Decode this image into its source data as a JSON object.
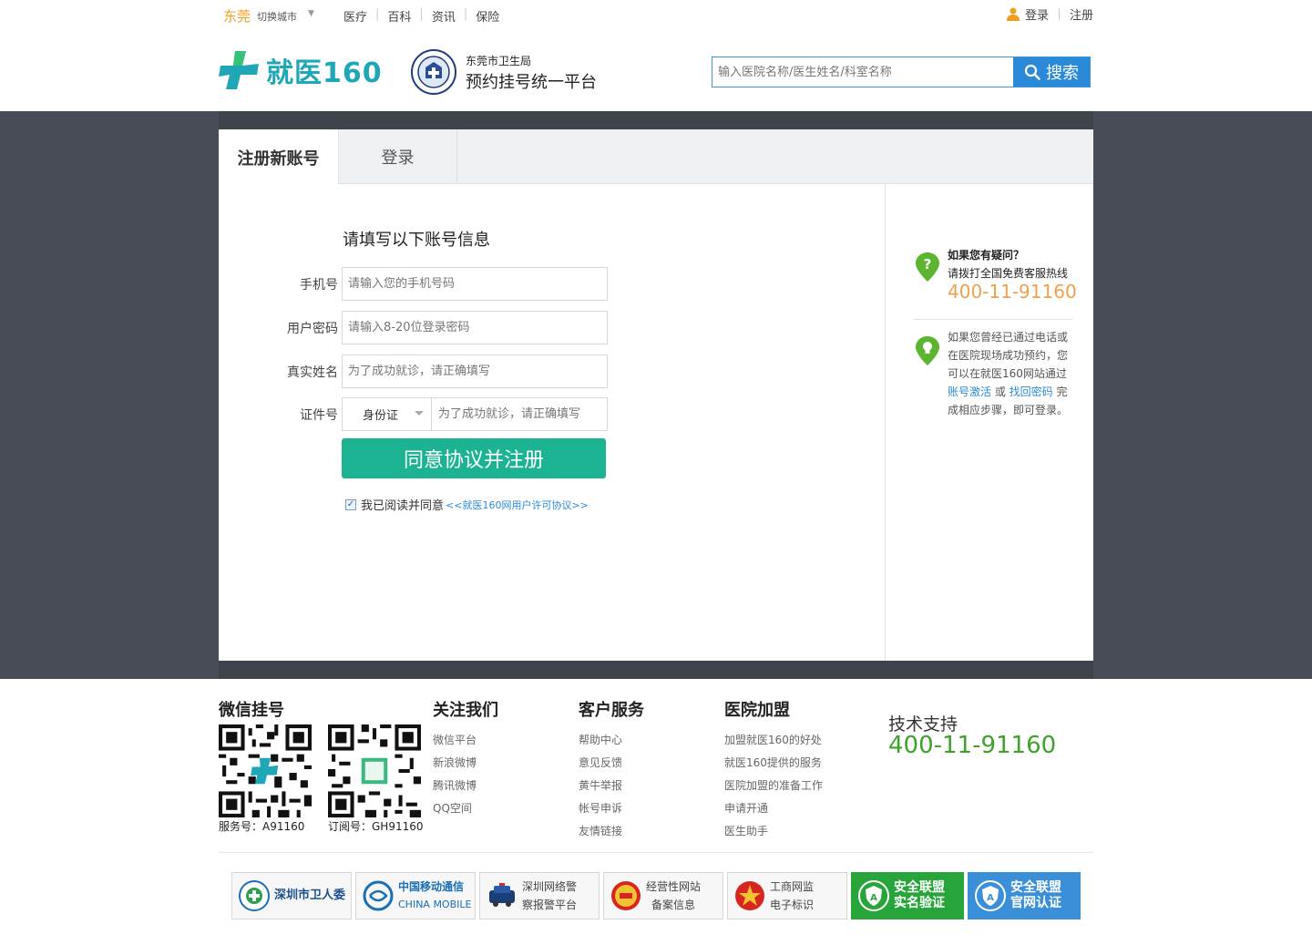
{
  "topbar": {
    "city": "东莞",
    "switch_city": "切换城市",
    "nav": [
      "医疗",
      "百科",
      "资讯",
      "保险"
    ],
    "login": "登录",
    "register": "注册"
  },
  "header": {
    "logo_text": "就医160",
    "gov_name": "东莞市卫生局",
    "platform_name": "预约挂号统一平台",
    "search_placeholder": "输入医院名称/医生姓名/科室名称",
    "search_button": "搜索"
  },
  "tabs": {
    "register": "注册新账号",
    "login": "登录"
  },
  "form": {
    "title": "请填写以下账号信息",
    "phone_label": "手机号",
    "phone_placeholder": "请输入您的手机号码",
    "password_label": "用户密码",
    "password_placeholder": "请输入8-20位登录密码",
    "name_label": "真实姓名",
    "name_placeholder": "为了成功就诊，请正确填写",
    "id_label": "证件号",
    "id_type": "身份证",
    "id_placeholder": "为了成功就诊，请正确填写",
    "submit": "同意协议并注册",
    "agree_text": "我已阅读并同意",
    "agree_link": "<<就医160网用户许可协议>>",
    "agree_checked": true
  },
  "side": {
    "q_title": "如果您有疑问？",
    "q_sub": "请拨打全国免费客服热线",
    "phone": "400-11-91160",
    "info_1": "如果您曾经已通过电话或在医院现场成功预约，您可以在就医160网站通过",
    "link_activate": "账号激活",
    "or": " 或 ",
    "link_recover": "找回密码",
    "info_2": " 完成相应步骤，即可登录。"
  },
  "footer": {
    "wechat_title": "微信挂号",
    "qr1_caption": "服务号：A91160",
    "qr2_caption": "订阅号：GH91160",
    "follow_title": "关注我们",
    "follow_items": [
      "微信平台",
      "新浪微博",
      "腾讯微博",
      "QQ空间"
    ],
    "service_title": "客户服务",
    "service_items": [
      "帮助中心",
      "意见反馈",
      "黄牛举报",
      "帐号申诉",
      "友情链接"
    ],
    "join_title": "医院加盟",
    "join_items": [
      "加盟就医160的好处",
      "就医160提供的服务",
      "医院加盟的准备工作",
      "申请开通",
      "医生助手"
    ],
    "tech_title": "技术支持",
    "tech_phone": "400-11-91160",
    "badges": [
      {
        "line1": "深圳市卫人委",
        "line2": ""
      },
      {
        "line1": "中国移动通信",
        "line2": "CHINA MOBILE"
      },
      {
        "line1": "深圳网络警",
        "line2": "察报警平台"
      },
      {
        "line1": "经营性网站",
        "line2": "备案信息"
      },
      {
        "line1": "工商网监",
        "line2": "电子标识"
      },
      {
        "line1": "安全联盟",
        "line2": "实名验证"
      },
      {
        "line1": "安全联盟",
        "line2": "官网认证"
      }
    ]
  },
  "colors": {
    "brand": "#1fa7b7",
    "button_green": "#1cb393",
    "search_blue": "#2b8ad8",
    "phone_orange": "#f0a050",
    "footer_green": "#3fa22a",
    "band": "#464b55"
  }
}
